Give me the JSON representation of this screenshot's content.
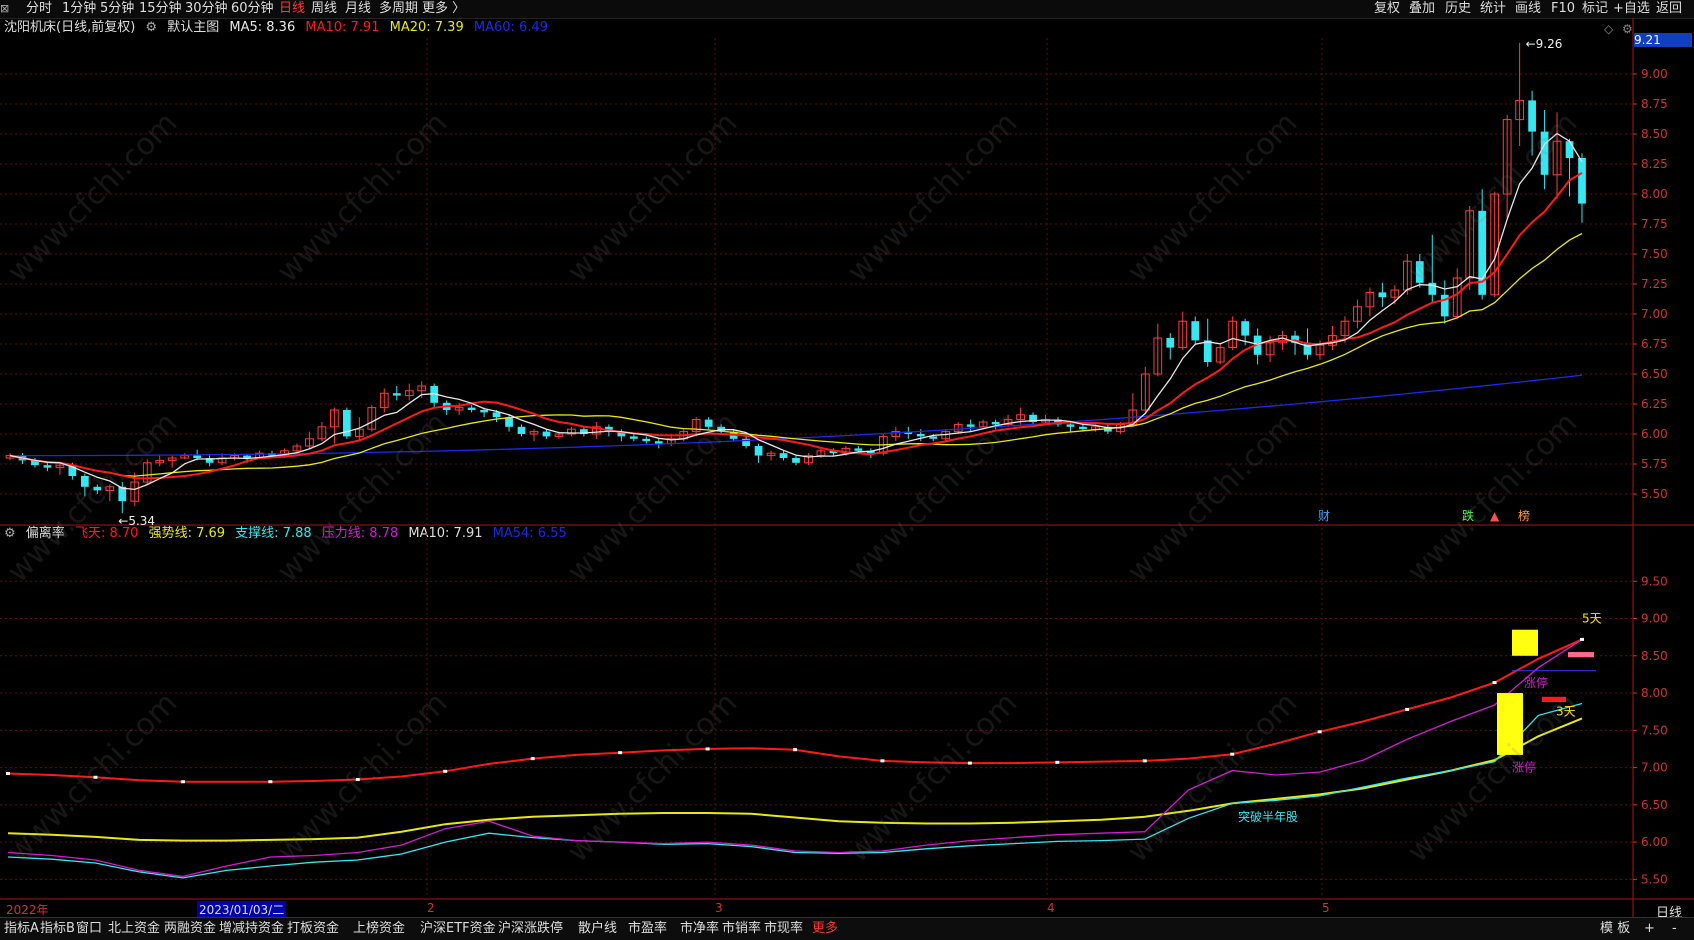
{
  "toolbar": {
    "periods": [
      "分时",
      "1分钟",
      "5分钟",
      "15分钟",
      "30分钟",
      "60分钟",
      "日线",
      "周线",
      "月线",
      "多周期",
      "更多 〉"
    ],
    "active_period": "日线",
    "right_items": [
      "复权",
      "叠加",
      "历史",
      "统计",
      "画线",
      "F10",
      "标记",
      "+自选",
      "返回"
    ]
  },
  "main_legend": {
    "title": "沈阳机床(日线,前复权)",
    "template": "默认主图",
    "ma5_label": "MA5: 8.36",
    "ma10_label": "MA10: 7.91",
    "ma20_label": "MA20: 7.39",
    "ma60_label": "MA60: 6.49"
  },
  "sub_legend": {
    "name": "偏离率",
    "fei_tian": "飞天: 8.70",
    "qiang_shi": "强势线: 7.69",
    "zhi_cheng": "支撑线: 7.88",
    "ya_li": "压力线: 8.78",
    "ma10": "MA10: 7.91",
    "ma54": "MA54: 6.55"
  },
  "colors": {
    "up": "#ff3b3b",
    "down": "#36e6f0",
    "ma5": "#e8e8e8",
    "ma10": "#ff1a1a",
    "ma20": "#e8e817",
    "ma60": "#1a2ae8",
    "magenta": "#d21cd2",
    "grid": "#5a1010",
    "axis": "#c33"
  },
  "current_price": "9.21",
  "date_axis": [
    "2022年",
    "2023/01/03/二",
    "2",
    "3",
    "4",
    "5"
  ],
  "day_label": "日线",
  "bottom_tabs": [
    "指标A",
    "指标B",
    "窗口",
    "北上资金",
    "两融资金",
    "增减持资金",
    "打板资金",
    "上榜资金",
    "沪深ETF资金",
    "沪深涨跌停",
    "散户线",
    "市盈率",
    "市净率",
    "市销率",
    "市现率",
    "更多"
  ],
  "bottom_right": [
    "模 板",
    "+",
    "-"
  ],
  "watermark": "www.cfchi.com",
  "chart_data": [
    {
      "type": "candlestick",
      "title": "沈阳机床(日线,前复权)",
      "ylim": [
        5.25,
        9.3
      ],
      "yticks": [
        "5.50",
        "5.75",
        "6.00",
        "6.25",
        "6.50",
        "6.75",
        "7.00",
        "7.25",
        "7.50",
        "7.75",
        "8.00",
        "8.25",
        "8.50",
        "8.75",
        "9.00"
      ],
      "high_label": "9.26",
      "low_label": "5.34",
      "markers": [
        "财",
        "跌",
        "▲",
        "榜"
      ],
      "candles": [
        [
          5.8,
          5.82,
          5.78,
          5.84
        ],
        [
          5.82,
          5.78,
          5.75,
          5.84
        ],
        [
          5.78,
          5.74,
          5.72,
          5.8
        ],
        [
          5.74,
          5.72,
          5.69,
          5.76
        ],
        [
          5.72,
          5.74,
          5.66,
          5.76
        ],
        [
          5.74,
          5.65,
          5.62,
          5.76
        ],
        [
          5.65,
          5.56,
          5.48,
          5.67
        ],
        [
          5.56,
          5.53,
          5.5,
          5.58
        ],
        [
          5.53,
          5.56,
          5.44,
          5.58
        ],
        [
          5.56,
          5.44,
          5.34,
          5.6
        ],
        [
          5.44,
          5.6,
          5.4,
          5.68
        ],
        [
          5.6,
          5.76,
          5.58,
          5.79
        ],
        [
          5.76,
          5.78,
          5.73,
          5.82
        ],
        [
          5.78,
          5.8,
          5.72,
          5.82
        ],
        [
          5.8,
          5.82,
          5.79,
          5.84
        ],
        [
          5.82,
          5.8,
          5.78,
          5.87
        ],
        [
          5.8,
          5.76,
          5.73,
          5.82
        ],
        [
          5.76,
          5.8,
          5.74,
          5.84
        ],
        [
          5.8,
          5.82,
          5.78,
          5.84
        ],
        [
          5.82,
          5.8,
          5.76,
          5.83
        ],
        [
          5.8,
          5.84,
          5.79,
          5.86
        ],
        [
          5.84,
          5.82,
          5.8,
          5.86
        ],
        [
          5.82,
          5.86,
          5.8,
          5.88
        ],
        [
          5.86,
          5.9,
          5.84,
          5.92
        ],
        [
          5.9,
          5.96,
          5.88,
          6.02
        ],
        [
          5.96,
          6.06,
          5.94,
          6.1
        ],
        [
          6.06,
          6.2,
          5.92,
          6.22
        ],
        [
          6.2,
          5.98,
          5.96,
          6.22
        ],
        [
          5.98,
          6.04,
          5.94,
          6.14
        ],
        [
          6.04,
          6.22,
          6.02,
          6.24
        ],
        [
          6.22,
          6.34,
          6.18,
          6.38
        ],
        [
          6.34,
          6.32,
          6.28,
          6.4
        ],
        [
          6.32,
          6.36,
          6.28,
          6.42
        ],
        [
          6.36,
          6.4,
          6.3,
          6.44
        ],
        [
          6.4,
          6.26,
          6.22,
          6.42
        ],
        [
          6.26,
          6.2,
          6.16,
          6.28
        ],
        [
          6.2,
          6.22,
          6.16,
          6.26
        ],
        [
          6.22,
          6.2,
          6.18,
          6.24
        ],
        [
          6.2,
          6.18,
          6.14,
          6.22
        ],
        [
          6.18,
          6.14,
          6.1,
          6.2
        ],
        [
          6.14,
          6.06,
          6.02,
          6.16
        ],
        [
          6.06,
          6.0,
          5.98,
          6.08
        ],
        [
          6.0,
          6.02,
          5.94,
          6.04
        ],
        [
          6.02,
          5.98,
          5.96,
          6.04
        ],
        [
          5.98,
          6.0,
          5.96,
          6.02
        ],
        [
          6.0,
          6.04,
          5.98,
          6.06
        ],
        [
          6.04,
          6.0,
          5.98,
          6.06
        ],
        [
          6.0,
          6.06,
          5.96,
          6.1
        ],
        [
          6.06,
          6.02,
          5.98,
          6.08
        ],
        [
          6.02,
          5.98,
          5.94,
          6.04
        ],
        [
          5.98,
          5.96,
          5.94,
          6.0
        ],
        [
          5.96,
          5.94,
          5.92,
          5.98
        ],
        [
          5.94,
          5.92,
          5.88,
          5.96
        ],
        [
          5.92,
          5.96,
          5.9,
          6.0
        ],
        [
          5.96,
          6.02,
          5.94,
          6.04
        ],
        [
          6.02,
          6.12,
          5.98,
          6.14
        ],
        [
          6.12,
          6.06,
          6.04,
          6.14
        ],
        [
          6.06,
          6.02,
          6.0,
          6.08
        ],
        [
          6.02,
          5.96,
          5.94,
          6.04
        ],
        [
          5.96,
          5.9,
          5.88,
          5.98
        ],
        [
          5.9,
          5.82,
          5.76,
          5.92
        ],
        [
          5.82,
          5.84,
          5.78,
          5.86
        ],
        [
          5.84,
          5.8,
          5.78,
          5.86
        ],
        [
          5.8,
          5.76,
          5.74,
          5.82
        ],
        [
          5.76,
          5.82,
          5.74,
          5.84
        ],
        [
          5.82,
          5.86,
          5.8,
          5.88
        ],
        [
          5.86,
          5.84,
          5.82,
          5.88
        ],
        [
          5.84,
          5.88,
          5.82,
          5.9
        ],
        [
          5.88,
          5.86,
          5.84,
          5.9
        ],
        [
          5.86,
          5.84,
          5.8,
          5.88
        ],
        [
          5.84,
          5.98,
          5.82,
          6.0
        ],
        [
          5.98,
          6.02,
          5.94,
          6.06
        ],
        [
          6.02,
          6.0,
          5.96,
          6.06
        ],
        [
          6.0,
          5.98,
          5.94,
          6.04
        ],
        [
          5.98,
          5.96,
          5.94,
          6.0
        ],
        [
          5.96,
          6.02,
          5.94,
          6.04
        ],
        [
          6.02,
          6.08,
          6.0,
          6.1
        ],
        [
          6.08,
          6.06,
          6.02,
          6.12
        ],
        [
          6.06,
          6.1,
          6.04,
          6.12
        ],
        [
          6.1,
          6.08,
          6.04,
          6.12
        ],
        [
          6.08,
          6.12,
          6.06,
          6.16
        ],
        [
          6.12,
          6.16,
          6.08,
          6.22
        ],
        [
          6.16,
          6.1,
          6.08,
          6.18
        ],
        [
          6.1,
          6.12,
          6.08,
          6.16
        ],
        [
          6.12,
          6.08,
          6.06,
          6.14
        ],
        [
          6.08,
          6.06,
          6.02,
          6.1
        ],
        [
          6.06,
          6.04,
          6.02,
          6.08
        ],
        [
          6.04,
          6.06,
          6.02,
          6.08
        ],
        [
          6.06,
          6.02,
          6.0,
          6.08
        ],
        [
          6.02,
          6.08,
          6.0,
          6.1
        ],
        [
          6.08,
          6.2,
          6.06,
          6.34
        ],
        [
          6.2,
          6.5,
          6.18,
          6.56
        ],
        [
          6.5,
          6.8,
          6.48,
          6.92
        ],
        [
          6.8,
          6.72,
          6.62,
          6.84
        ],
        [
          6.72,
          6.94,
          6.7,
          7.02
        ],
        [
          6.94,
          6.78,
          6.74,
          6.98
        ],
        [
          6.78,
          6.6,
          6.56,
          6.96
        ],
        [
          6.6,
          6.72,
          6.58,
          6.76
        ],
        [
          6.72,
          6.94,
          6.7,
          6.98
        ],
        [
          6.94,
          6.82,
          6.74,
          6.96
        ],
        [
          6.82,
          6.66,
          6.58,
          6.88
        ],
        [
          6.66,
          6.76,
          6.6,
          6.82
        ],
        [
          6.76,
          6.82,
          6.7,
          6.86
        ],
        [
          6.82,
          6.76,
          6.66,
          6.86
        ],
        [
          6.76,
          6.66,
          6.62,
          6.88
        ],
        [
          6.66,
          6.74,
          6.62,
          6.78
        ],
        [
          6.74,
          6.82,
          6.7,
          6.9
        ],
        [
          6.82,
          6.94,
          6.76,
          6.98
        ],
        [
          6.94,
          7.06,
          6.88,
          7.12
        ],
        [
          7.06,
          7.18,
          6.98,
          7.22
        ],
        [
          7.18,
          7.14,
          7.06,
          7.26
        ],
        [
          7.14,
          7.2,
          7.08,
          7.24
        ],
        [
          7.2,
          7.44,
          7.16,
          7.5
        ],
        [
          7.44,
          7.26,
          7.22,
          7.5
        ],
        [
          7.26,
          7.16,
          7.1,
          7.66
        ],
        [
          7.16,
          6.98,
          6.92,
          7.28
        ],
        [
          6.98,
          7.3,
          6.96,
          7.38
        ],
        [
          7.3,
          7.86,
          7.2,
          7.9
        ],
        [
          7.86,
          7.16,
          7.12,
          8.04
        ],
        [
          7.16,
          8.0,
          7.14,
          8.02
        ],
        [
          8.0,
          8.62,
          7.8,
          8.66
        ],
        [
          8.62,
          8.78,
          8.4,
          9.26
        ],
        [
          8.78,
          8.52,
          8.32,
          8.86
        ],
        [
          8.52,
          8.16,
          8.04,
          8.7
        ],
        [
          8.16,
          8.44,
          7.96,
          8.68
        ],
        [
          8.44,
          8.3,
          7.98,
          8.46
        ],
        [
          8.3,
          7.92,
          7.76,
          8.34
        ]
      ],
      "ma5_end": 8.36,
      "ma10_end": 7.91,
      "ma20_end": 7.39,
      "ma60_end": 6.49
    },
    {
      "type": "line",
      "title": "偏离率",
      "ylim": [
        5.25,
        10.0
      ],
      "yticks": [
        "5.50",
        "6.00",
        "6.50",
        "7.00",
        "7.50",
        "8.00",
        "8.50",
        "9.00",
        "9.50"
      ],
      "annotations": [
        "5天",
        "涨停",
        "3天",
        "涨停",
        "突破半年股"
      ],
      "series": [
        {
          "name": "压力线",
          "values": [
            6.92,
            6.9,
            6.87,
            6.83,
            6.81,
            6.81,
            6.81,
            6.82,
            6.84,
            6.88,
            6.95,
            7.05,
            7.12,
            7.17,
            7.2,
            7.23,
            7.25,
            7.26,
            7.24,
            7.15,
            7.09,
            7.07,
            7.06,
            7.06,
            7.07,
            7.08,
            7.09,
            7.12,
            7.18,
            7.32,
            7.48,
            7.62,
            7.78,
            7.94,
            8.14,
            8.46,
            8.72
          ]
        },
        {
          "name": "强势线",
          "values": [
            6.12,
            6.1,
            6.07,
            6.03,
            6.02,
            6.02,
            6.03,
            6.04,
            6.06,
            6.14,
            6.24,
            6.3,
            6.34,
            6.36,
            6.38,
            6.39,
            6.39,
            6.38,
            6.33,
            6.28,
            6.26,
            6.25,
            6.25,
            6.26,
            6.28,
            6.3,
            6.34,
            6.42,
            6.52,
            6.58,
            6.64,
            6.72,
            6.84,
            6.96,
            7.1,
            7.42,
            7.66
          ]
        },
        {
          "name": "支撑线",
          "values": [
            5.8,
            5.77,
            5.72,
            5.6,
            5.52,
            5.62,
            5.68,
            5.73,
            5.76,
            5.84,
            6.0,
            6.12,
            6.06,
            6.02,
            6.0,
            5.97,
            5.98,
            5.94,
            5.86,
            5.85,
            5.86,
            5.91,
            5.95,
            5.98,
            6.01,
            6.02,
            6.04,
            6.32,
            6.52,
            6.56,
            6.62,
            6.74,
            6.86,
            6.96,
            7.08,
            7.7,
            7.86
          ]
        },
        {
          "name": "飞天",
          "values": [
            5.86,
            5.82,
            5.76,
            5.62,
            5.54,
            5.68,
            5.8,
            5.82,
            5.86,
            5.96,
            6.18,
            6.28,
            6.08,
            6.02,
            6.0,
            5.98,
            6.0,
            5.96,
            5.88,
            5.86,
            5.88,
            5.96,
            6.02,
            6.06,
            6.1,
            6.12,
            6.14,
            6.7,
            6.96,
            6.9,
            6.94,
            7.1,
            7.38,
            7.62,
            7.84,
            8.34,
            8.72
          ]
        }
      ]
    }
  ]
}
